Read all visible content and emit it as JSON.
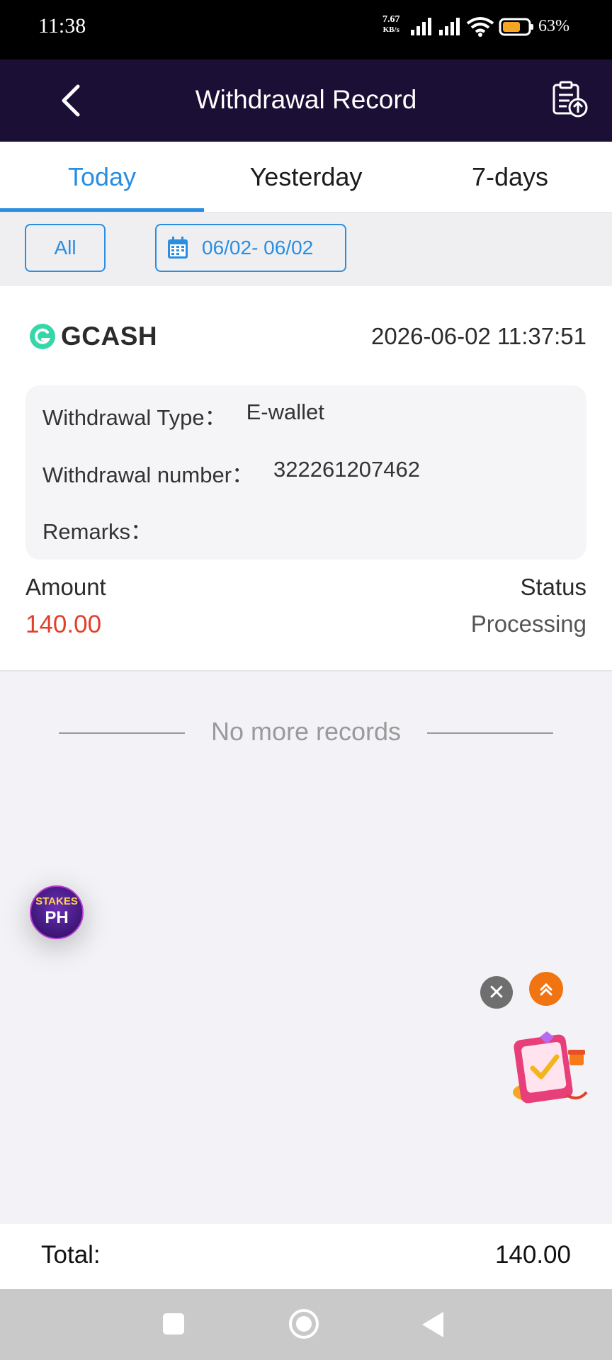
{
  "status_bar": {
    "time": "11:38",
    "net_speed_value": "7.67",
    "net_speed_unit": "KB/s",
    "battery_percent": "63%"
  },
  "header": {
    "title": "Withdrawal Record",
    "back_icon": "chevron-left-icon",
    "action_icon": "clipboard-upload-icon"
  },
  "tabs": [
    {
      "label": "Today",
      "active": true
    },
    {
      "label": "Yesterday",
      "active": false
    },
    {
      "label": "7-days",
      "active": false
    }
  ],
  "filters": {
    "all_label": "All",
    "date_range": "06/02- 06/02",
    "calendar_icon": "calendar-icon"
  },
  "record": {
    "method": "GCASH",
    "datetime": "2026-06-02 11:37:51",
    "type_label": "Withdrawal Type：",
    "type_value": "E-wallet",
    "number_label": "Withdrawal number：",
    "number_value": "322261207462",
    "remarks_label": "Remarks：",
    "remarks_value": "",
    "amount_label": "Amount",
    "amount_value": "140.00",
    "status_label": "Status",
    "status_value": "Processing"
  },
  "list_end_text": "No more records",
  "floating": {
    "stakes_line1": "STAKES",
    "stakes_line2": "PH",
    "close_icon": "close-icon",
    "scroll_top_icon": "double-chevron-up-icon",
    "gift_icon": "gift-task-icon"
  },
  "footer": {
    "total_label": "Total:",
    "total_value": "140.00"
  },
  "colors": {
    "accent": "#2a8ee0",
    "header_bg": "#1b0f36",
    "amount": "#e0412a",
    "scroll_top": "#f07412"
  }
}
